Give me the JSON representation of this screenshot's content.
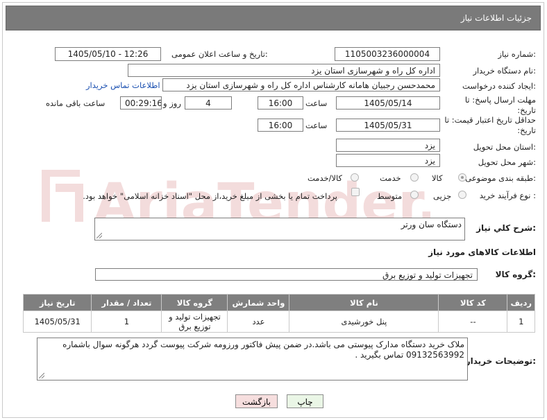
{
  "header": {
    "title": "جزئیات اطلاعات نیاز"
  },
  "form": {
    "need_number_label": "شماره نیاز:",
    "need_number": "1105003236000004",
    "announce_label": "تاریخ و ساعت اعلان عمومی:",
    "announce_value": "1405/05/10 - 12:26",
    "buyer_org_label": "نام دستگاه خریدار:",
    "buyer_org": "اداره کل راه و شهرسازی استان یزد",
    "requester_label": "ایجاد کننده درخواست:",
    "requester": "محمدحسن رجبیان هامانه کارشناس اداره کل راه و شهرسازی استان یزد",
    "buyer_contact_link": "اطلاعات تماس خریدار",
    "deadline_label": "مهلت ارسال پاسخ: تا تاریخ:",
    "deadline_date": "1405/05/14",
    "time_label": "ساعت",
    "deadline_time": "16:00",
    "days_value": "4",
    "days_label": "روز و",
    "remaining_time": "00:29:16",
    "remaining_label": "ساعت باقی مانده",
    "price_valid_label": "حداقل تاریخ اعتبار قیمت: تا تاریخ:",
    "price_valid_date": "1405/05/31",
    "price_valid_time_label": "ساعت",
    "price_valid_time": "16:00",
    "province_label": "استان محل تحویل:",
    "province": "یزد",
    "city_label": "شهر محل تحویل:",
    "city": "یزد",
    "category_label": "طبقه بندی موضوعی:",
    "category_options": [
      "کالا",
      "خدمت",
      "کالا/خدمت"
    ],
    "category_selected": "کالا",
    "process_label": "نوع فرآیند خرید :",
    "process_options": [
      "جزیی",
      "متوسط"
    ],
    "treasury_note": "پرداخت تمام یا بخشی از مبلغ خرید،از محل \"اسناد خزانه اسلامی\" خواهد بود.",
    "description_label": "شرح کلي نياز:",
    "description": "دستگاه سان ورتر"
  },
  "goods": {
    "section_title": "اطلاعات کالاهای مورد نیاز",
    "group_label": "گروه کالا:",
    "group_value": "تجهیزات تولید و توزیع برق",
    "table": {
      "headers": [
        "ردیف",
        "کد کالا",
        "نام کالا",
        "واحد شمارش",
        "گروه کالا",
        "تعداد / مقدار",
        "تاریخ نیاز"
      ],
      "rows": [
        [
          "1",
          "--",
          "پنل خورشیدی",
          "عدد",
          "تجهیزات تولید و توزیع برق",
          "1",
          "1405/05/31"
        ]
      ]
    }
  },
  "buyer_notes": {
    "label": "توضیحات خریدار:",
    "text": "ملاک خرید دستگاه مدارک پیوستی می باشد.در ضمن پیش فاکتور ورزومه شرکت پیوست گردد هرگونه سوال باشماره 09132563992 تماس بگیرید ."
  },
  "buttons": {
    "print": "چاپ",
    "back": "بازگشت"
  },
  "watermark": {
    "text": "AriaTender.neT"
  },
  "colors": {
    "header_bg": "#7a7a7a",
    "link": "#1a4fb0",
    "back_button_bg": "#f6dede",
    "print_button_bg": "#eaf6e6"
  }
}
